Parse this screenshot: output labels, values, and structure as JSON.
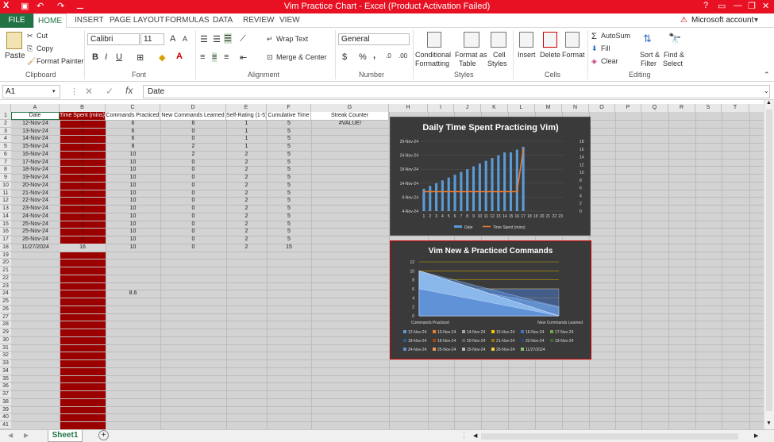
{
  "window": {
    "title": "Vim Practice Chart -  Excel (Product Activation Failed)",
    "help": "?",
    "account": "Microsoft account"
  },
  "tabs": [
    "FILE",
    "HOME",
    "INSERT",
    "PAGE LAYOUT",
    "FORMULAS",
    "DATA",
    "REVIEW",
    "VIEW"
  ],
  "ribbon": {
    "clipboard": {
      "paste": "Paste",
      "cut": "Cut",
      "copy": "Copy",
      "format_painter": "Format Painter",
      "label": "Clipboard"
    },
    "font": {
      "name": "Calibri",
      "size": "11",
      "bold": "B",
      "italic": "I",
      "underline": "U",
      "label": "Font",
      "grow": "A",
      "shrink": "A"
    },
    "alignment": {
      "wrap": "Wrap Text",
      "merge": "Merge & Center",
      "label": "Alignment"
    },
    "number": {
      "format": "General",
      "currency": "$",
      "percent": "%",
      "comma": ",",
      "label": "Number"
    },
    "styles": {
      "conditional": "Conditional",
      "conditional2": "Formatting",
      "format_table": "Format as",
      "format_table2": "Table",
      "cell_styles": "Cell",
      "cell_styles2": "Styles",
      "label": "Styles"
    },
    "cells": {
      "insert": "Insert",
      "delete": "Delete",
      "format": "Format",
      "label": "Cells"
    },
    "editing": {
      "autosum": "AutoSum",
      "fill": "Fill",
      "clear": "Clear",
      "sort": "Sort &",
      "sort2": "Filter",
      "find": "Find &",
      "find2": "Select",
      "label": "Editing"
    }
  },
  "formula_bar": {
    "name_box": "A1",
    "content": "Date",
    "fx": "fx"
  },
  "columns": [
    "A",
    "B",
    "C",
    "D",
    "E",
    "F",
    "G",
    "H",
    "I",
    "J",
    "K",
    "L",
    "M",
    "N",
    "O",
    "P",
    "Q",
    "R",
    "S",
    "T"
  ],
  "headers": [
    "Date",
    "Time Spent (mins)",
    "Commands Practiced",
    "New Commands Learned",
    "Self-Rating (1-5)",
    "Cumulative Time",
    "Streak Counter"
  ],
  "rows": [
    [
      "12-Nov-24",
      "5",
      "6",
      "6",
      "1",
      "5",
      "#VALUE!"
    ],
    [
      "13-Nov-24",
      "5",
      "6",
      "0",
      "1",
      "5",
      ""
    ],
    [
      "14-Nov-24",
      "5",
      "6",
      "0",
      "1",
      "5",
      ""
    ],
    [
      "15-Nov-24",
      "5",
      "8",
      "2",
      "1",
      "5",
      ""
    ],
    [
      "16-Nov-24",
      "5",
      "10",
      "2",
      "2",
      "5",
      ""
    ],
    [
      "17-Nov-24",
      "5",
      "10",
      "0",
      "2",
      "5",
      ""
    ],
    [
      "18-Nov-24",
      "5",
      "10",
      "0",
      "2",
      "5",
      ""
    ],
    [
      "19-Nov-24",
      "5",
      "10",
      "0",
      "2",
      "5",
      ""
    ],
    [
      "20-Nov-24",
      "5",
      "10",
      "0",
      "2",
      "5",
      ""
    ],
    [
      "21-Nov-24",
      "5",
      "10",
      "0",
      "2",
      "5",
      ""
    ],
    [
      "22-Nov-24",
      "5",
      "10",
      "0",
      "2",
      "5",
      ""
    ],
    [
      "23-Nov-24",
      "5",
      "10",
      "0",
      "2",
      "5",
      ""
    ],
    [
      "24-Nov-24",
      "5",
      "10",
      "0",
      "2",
      "5",
      ""
    ],
    [
      "25-Nov-24",
      "5",
      "10",
      "0",
      "2",
      "5",
      ""
    ],
    [
      "25-Nov-24",
      "5",
      "10",
      "0",
      "2",
      "5",
      ""
    ],
    [
      "26-Nov-24",
      "5",
      "10",
      "0",
      "2",
      "5",
      ""
    ],
    [
      "11/27/2024",
      "16",
      "10",
      "0",
      "2",
      "15",
      ""
    ]
  ],
  "extra_cell": {
    "value": "8.6"
  },
  "row_numbers": [
    "1",
    "2",
    "3",
    "4",
    "5",
    "6",
    "7",
    "8",
    "9",
    "10",
    "11",
    "12",
    "13",
    "14",
    "15",
    "16",
    "17",
    "18",
    "19",
    "20",
    "21",
    "22",
    "23",
    "24",
    "25",
    "26",
    "27",
    "28",
    "29",
    "30",
    "31",
    "32",
    "33",
    "34",
    "35",
    "36",
    "37",
    "38",
    "39",
    "40",
    "41"
  ],
  "sheet": {
    "name": "Sheet1",
    "add": "+"
  },
  "chart_data": [
    {
      "type": "bar",
      "title": "Daily Time Spent Practicing Vim)",
      "categories": [
        "1",
        "2",
        "3",
        "4",
        "5",
        "6",
        "7",
        "8",
        "9",
        "10",
        "11",
        "12",
        "13",
        "14",
        "15",
        "16",
        "17",
        "18",
        "19",
        "20",
        "21",
        "22",
        "23"
      ],
      "left_ticks": [
        "29-Nov-24",
        "24-Nov-24",
        "19-Nov-24",
        "14-Nov-24",
        "9-Nov-24",
        "4-Nov-24"
      ],
      "right_ticks": [
        "18",
        "16",
        "14",
        "12",
        "10",
        "8",
        "6",
        "4",
        "2",
        "0"
      ],
      "ylim_right": [
        0,
        18
      ],
      "series": [
        {
          "name": "Date",
          "color": "#5b9bd5",
          "values": [
            12,
            13,
            14,
            15,
            16,
            17,
            18,
            19,
            20,
            21,
            22,
            23,
            24,
            25,
            25,
            26,
            27
          ]
        },
        {
          "name": "Time Spent (mins)",
          "color": "#ed7d31",
          "values": [
            5,
            5,
            5,
            5,
            5,
            5,
            5,
            5,
            5,
            5,
            5,
            5,
            5,
            5,
            5,
            5,
            16
          ]
        }
      ],
      "legend": "bottom"
    },
    {
      "type": "area",
      "title": "Vim New & Practiced Commands",
      "categories": [
        "Commands Practiced",
        "New Commands Learned"
      ],
      "yticks": [
        "12",
        "10",
        "8",
        "6",
        "4",
        "2",
        "0"
      ],
      "ylim": [
        0,
        12
      ],
      "series": [
        {
          "name": "12-Nov-24",
          "values": [
            6,
            6
          ]
        },
        {
          "name": "13-Nov-24",
          "values": [
            6,
            0
          ]
        },
        {
          "name": "14-Nov-24",
          "values": [
            6,
            0
          ]
        },
        {
          "name": "15-Nov-24",
          "values": [
            8,
            2
          ]
        },
        {
          "name": "16-Nov-24",
          "values": [
            10,
            2
          ]
        },
        {
          "name": "17-Nov-24",
          "values": [
            10,
            0
          ]
        },
        {
          "name": "18-Nov-24",
          "values": [
            10,
            0
          ]
        },
        {
          "name": "19-Nov-24",
          "values": [
            10,
            0
          ]
        },
        {
          "name": "20-Nov-24",
          "values": [
            10,
            0
          ]
        },
        {
          "name": "21-Nov-24",
          "values": [
            10,
            0
          ]
        },
        {
          "name": "22-Nov-24",
          "values": [
            10,
            0
          ]
        },
        {
          "name": "23-Nov-24",
          "values": [
            10,
            0
          ]
        },
        {
          "name": "24-Nov-24",
          "values": [
            10,
            0
          ]
        },
        {
          "name": "25-Nov-24",
          "values": [
            10,
            0
          ]
        },
        {
          "name": "25-Nov-24",
          "values": [
            10,
            0
          ]
        },
        {
          "name": "26-Nov-24",
          "values": [
            10,
            0
          ]
        },
        {
          "name": "11/27/2024",
          "values": [
            10,
            0
          ]
        }
      ],
      "legend_colors": [
        "#5b9bd5",
        "#ed7d31",
        "#a5a5a5",
        "#ffc000",
        "#4472c4",
        "#70ad47",
        "#255e91",
        "#9e480e",
        "#636363",
        "#997300",
        "#264478",
        "#43682b",
        "#698ed0",
        "#f1975a",
        "#b7b7b7",
        "#ffcd33",
        "#8cc168"
      ],
      "legend": "bottom"
    }
  ]
}
